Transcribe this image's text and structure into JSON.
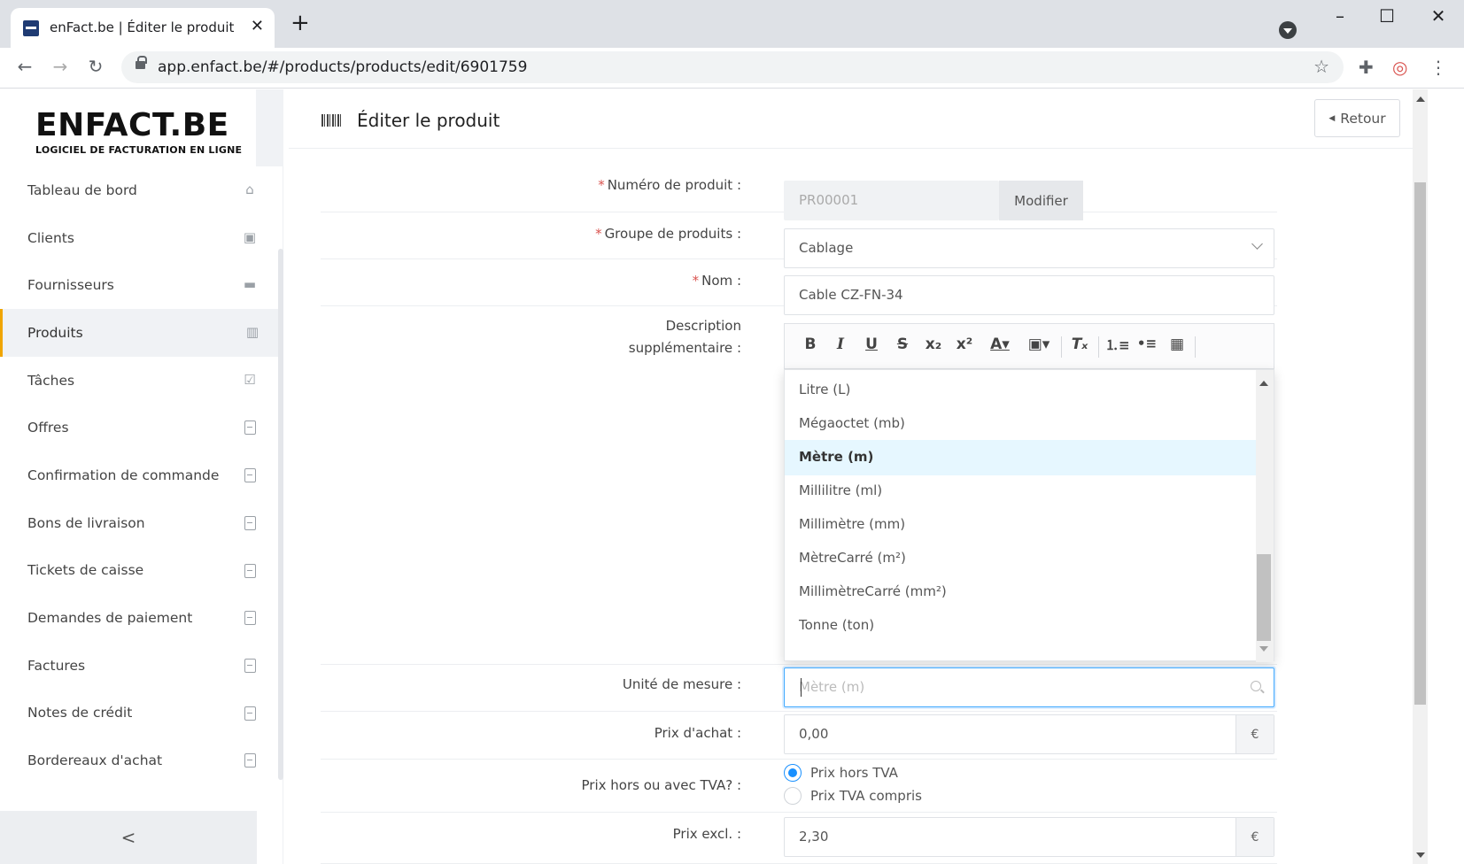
{
  "browser": {
    "tab_title": "enFact.be | Éditer le produit",
    "url": "app.enfact.be/#/products/products/edit/6901759"
  },
  "logo": {
    "main": "ENFACT.BE",
    "sub": "LOGICIEL DE FACTURATION EN LIGNE"
  },
  "sidebar": {
    "items": [
      {
        "label": "Tableau de bord",
        "icon": "home-icon"
      },
      {
        "label": "Clients",
        "icon": "contacts-icon"
      },
      {
        "label": "Fournisseurs",
        "icon": "truck-icon"
      },
      {
        "label": "Produits",
        "icon": "barcode-icon",
        "active": true
      },
      {
        "label": "Tâches",
        "icon": "checklist-icon"
      },
      {
        "label": "Offres",
        "icon": "pdf-icon"
      },
      {
        "label": "Confirmation de commande",
        "icon": "pdf-icon"
      },
      {
        "label": "Bons de livraison",
        "icon": "pdf-icon"
      },
      {
        "label": "Tickets de caisse",
        "icon": "pdf-icon"
      },
      {
        "label": "Demandes de paiement",
        "icon": "pdf-icon"
      },
      {
        "label": "Factures",
        "icon": "pdf-icon"
      },
      {
        "label": "Notes de crédit",
        "icon": "pdf-icon"
      },
      {
        "label": "Bordereaux d'achat",
        "icon": "pdf-icon"
      }
    ],
    "collapse_label": "<"
  },
  "header": {
    "title": "Éditer le produit",
    "back_label": "Retour"
  },
  "form": {
    "product_number": {
      "label": "Numéro de produit",
      "value": "PR00001",
      "button": "Modifier"
    },
    "product_group": {
      "label": "Groupe de produits",
      "value": "Cablage"
    },
    "name": {
      "label": "Nom",
      "value": "Cable CZ-FN-34"
    },
    "description": {
      "label_line1": "Description",
      "label_line2": "supplémentaire"
    },
    "unit": {
      "label": "Unité de mesure",
      "placeholder": "Mètre (m)",
      "options": [
        "Litre (L)",
        "Mégaoctet (mb)",
        "Mètre (m)",
        "Millilitre (ml)",
        "Millimètre (mm)",
        "MètreCarré (m²)",
        "MillimètreCarré (mm²)",
        "Tonne (ton)"
      ],
      "selected": "Mètre (m)"
    },
    "purchase_price": {
      "label": "Prix d'achat",
      "value": "0,00",
      "currency": "€"
    },
    "vat_mode": {
      "label": "Prix hors ou avec TVA?",
      "options": [
        "Prix hors TVA",
        "Prix TVA compris"
      ],
      "selected": "Prix hors TVA"
    },
    "price_excl": {
      "label": "Prix excl.",
      "value": "2,30",
      "currency": "€"
    }
  },
  "colors": {
    "accent": "#1890ff",
    "active_nav": "#f0a500",
    "required": "#d9534f"
  }
}
